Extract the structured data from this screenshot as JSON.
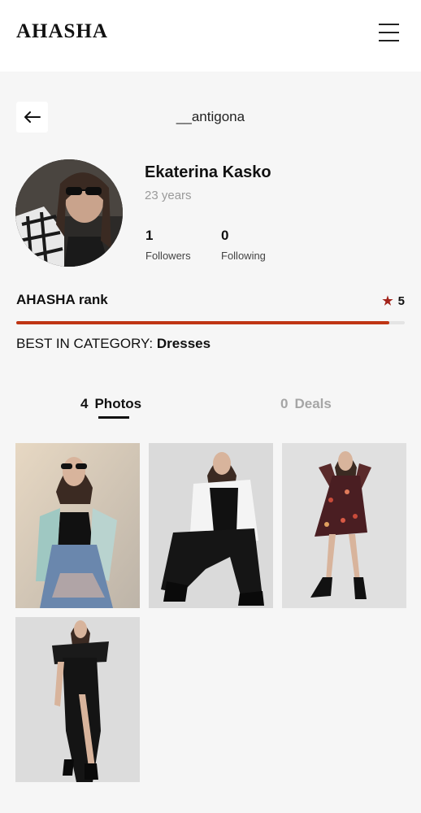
{
  "header": {
    "logo": "AHASHA",
    "menu_icon": "hamburger-menu-icon"
  },
  "profile": {
    "back_icon": "arrow-left-icon",
    "username": "__antigona",
    "name": "Ekaterina Kasko",
    "age": "23 years",
    "followers_count": "1",
    "followers_label": "Followers",
    "following_count": "0",
    "following_label": "Following"
  },
  "rank": {
    "label": "AHASHA rank",
    "star_icon": "star-icon",
    "score": "5",
    "progress_fraction": 0.96,
    "bar_color": "#bf3514"
  },
  "best": {
    "prefix": "BEST IN CATEGORY:",
    "category": "Dresses"
  },
  "tabs": [
    {
      "count": "4",
      "label": "Photos",
      "active": true
    },
    {
      "count": "0",
      "label": "Deals",
      "active": false
    }
  ],
  "photos": [
    {
      "description": "woman in sunglasses, black top, plaid shirt, jeans, sitting"
    },
    {
      "description": "woman in white cardigan, black pants, sitting on floor"
    },
    {
      "description": "woman in floral dress and black boots, standing"
    },
    {
      "description": "woman in black off-shoulder dress with slit, standing"
    }
  ]
}
